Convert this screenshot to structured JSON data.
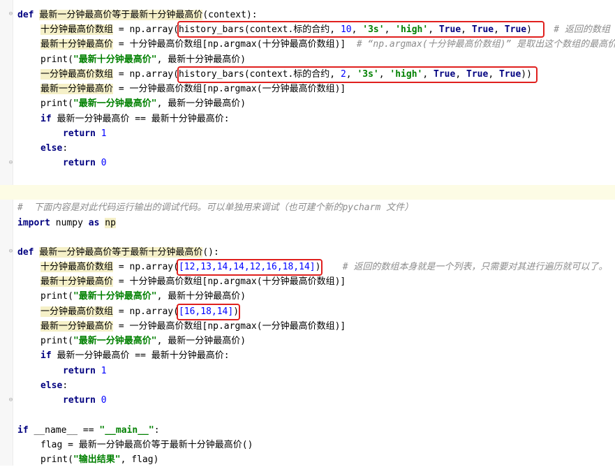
{
  "block1": {
    "def_line": {
      "kw": "def",
      "name": "最新一分钟最高价等于最新十分钟最高价",
      "args": "(context):"
    },
    "l2": {
      "var": "十分钟最高价数组",
      "mid": " = np.array(",
      "fn": "history_bars(context.标的合约, ",
      "n": "10",
      "sep1": ", ",
      "s1": "'3s'",
      "sep2": ", ",
      "s2": "'high'",
      "sep3": ", ",
      "t1": "True",
      "sep4": ", ",
      "t2": "True",
      "sep5": ", ",
      "t3": "True",
      "close": ")",
      "comment": "# 返回的数组"
    },
    "l3": {
      "var": "最新十分钟最高价",
      "mid": " = 十分钟最高价数组[np.argmax(十分钟最高价数组)]",
      "comment": "# “np.argmax(十分钟最高价数组)” 是取出这个数组的最高价"
    },
    "l4": {
      "fn": "print(",
      "s": "\"最新十分钟最高价\"",
      "rest": ", 最新十分钟最高价)"
    },
    "l5": {
      "var": "一分钟最高价数组",
      "mid": " = np.array(",
      "fn": "history_bars(context.标的合约, ",
      "n": "2",
      "sep1": ", ",
      "s1": "'3s'",
      "sep2": ", ",
      "s2": "'high'",
      "sep3": ", ",
      "t1": "True",
      "sep4": ", ",
      "t2": "True",
      "sep5": ", ",
      "t3": "True",
      "close": "))"
    },
    "l6": {
      "var": "最新一分钟最高价",
      "mid": " = 一分钟最高价数组[np.argmax(一分钟最高价数组)]"
    },
    "l7": {
      "fn": "print(",
      "s": "\"最新一分钟最高价\"",
      "rest": ", 最新一分钟最高价)"
    },
    "l8": {
      "kw": "if",
      "rest": " 最新一分钟最高价 == 最新十分钟最高价:"
    },
    "l9": {
      "kw": "return",
      "n": "1"
    },
    "l10": {
      "kw": "else",
      "rest": ":"
    },
    "l11": {
      "kw": "return",
      "n": "0"
    }
  },
  "comment_line": "#  下面内容是对此代码运行输出的调试代码。可以单独用来调试（也可建个新的pycharm 文件）",
  "import_line": {
    "kw1": "import",
    "mod": " numpy ",
    "kw2": "as",
    "alias": "np"
  },
  "block2": {
    "def_line": {
      "kw": "def",
      "name": "最新一分钟最高价等于最新十分钟最高价",
      "args": "():"
    },
    "l2": {
      "var": "十分钟最高价数组",
      "mid": " = np.array(",
      "list": "[12,13,14,14,12,16,18,14]",
      "close": ")",
      "comment": "# 返回的数组本身就是一个列表，只需要对其进行遍历就可以了。"
    },
    "l3": {
      "var": "最新十分钟最高价",
      "mid": " = 十分钟最高价数组[np.argmax(十分钟最高价数组)]"
    },
    "l4": {
      "fn": "print(",
      "s": "\"最新十分钟最高价\"",
      "rest": ", 最新十分钟最高价)"
    },
    "l5": {
      "var": "一分钟最高价数组",
      "mid": " = np.array(",
      "list": "[16,18,14]",
      "close": ")"
    },
    "l6": {
      "var": "最新一分钟最高价",
      "mid": " = 一分钟最高价数组[np.argmax(一分钟最高价数组)]"
    },
    "l7": {
      "fn": "print(",
      "s": "\"最新一分钟最高价\"",
      "rest": ", 最新一分钟最高价)"
    },
    "l8": {
      "kw": "if",
      "rest": " 最新一分钟最高价 == 最新十分钟最高价:"
    },
    "l9": {
      "kw": "return",
      "n": "1"
    },
    "l10": {
      "kw": "else",
      "rest": ":"
    },
    "l11": {
      "kw": "return",
      "n": "0"
    }
  },
  "main": {
    "if_line": {
      "kw": "if",
      "rest": " __name__ == ",
      "s": "\"__main__\"",
      "colon": ":"
    },
    "flag_line": "flag = 最新一分钟最高价等于最新十分钟最高价()",
    "print_line": {
      "fn": "print(",
      "s": "\"输出结果\"",
      "rest": ", flag)"
    }
  },
  "colors": {
    "keyword": "#000080",
    "string": "#008000",
    "number": "#0000ff",
    "comment": "#8c8c8c",
    "highlight_box": "#e0201e"
  }
}
